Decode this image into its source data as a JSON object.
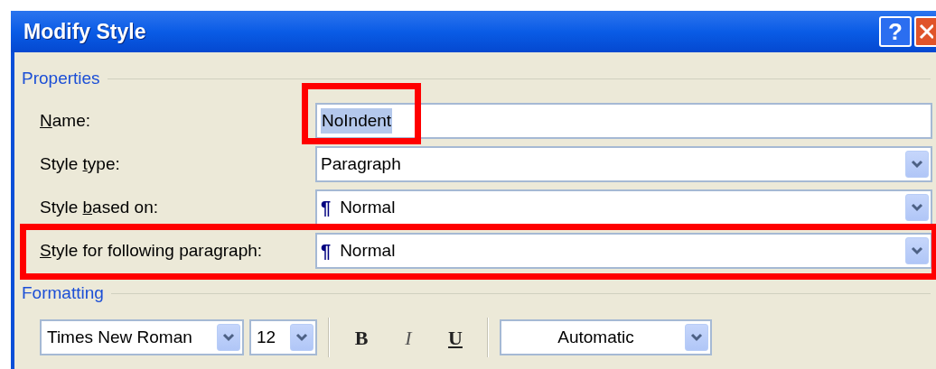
{
  "window": {
    "title": "Modify Style",
    "help_button": "?"
  },
  "properties": {
    "legend": "Properties",
    "rows": [
      {
        "kind": "text",
        "label": {
          "key": "N",
          "after": "ame:"
        },
        "value": "NoIndent",
        "value_selected": true,
        "highlighted": true
      },
      {
        "kind": "combo",
        "label": {
          "before": "Style ",
          "key": "t",
          "after": "ype:"
        },
        "value": "Paragraph",
        "highlighted": false
      },
      {
        "kind": "combo",
        "label": {
          "before": "Style ",
          "key": "b",
          "after": "ased on:"
        },
        "symbol": "¶",
        "value": "Normal",
        "highlighted": false
      },
      {
        "kind": "combo",
        "label": {
          "key": "S",
          "after": "tyle for following paragraph:"
        },
        "symbol": "¶",
        "value": "Normal",
        "highlighted": true
      }
    ]
  },
  "formatting": {
    "legend": "Formatting",
    "toolbar": [
      {
        "kind": "combo",
        "value": "Times New Roman"
      },
      {
        "kind": "combo",
        "value": "12"
      },
      {
        "kind": "separator"
      },
      {
        "kind": "bold",
        "text": "B"
      },
      {
        "kind": "italic",
        "text": "I"
      },
      {
        "kind": "underline",
        "text": "U"
      },
      {
        "kind": "separator"
      },
      {
        "kind": "combo",
        "value": "Automatic"
      }
    ]
  }
}
